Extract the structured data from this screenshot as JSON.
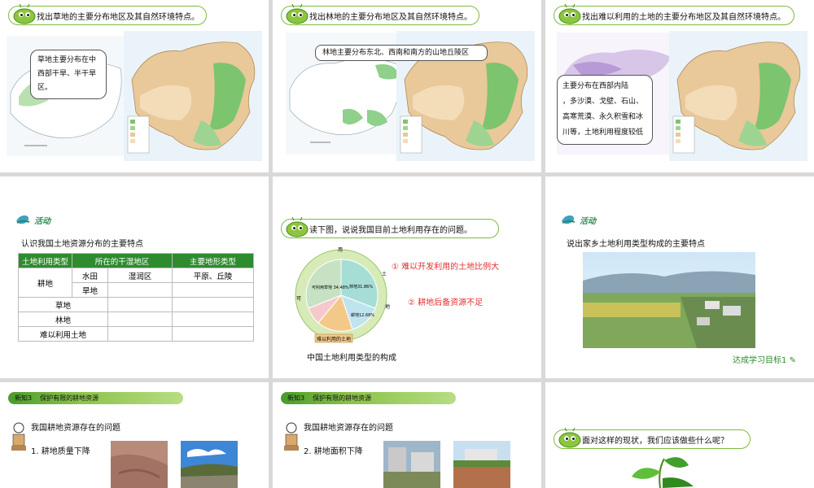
{
  "slide1": {
    "title": "找出草地的主要分布地区及其自然环境特点。",
    "bubble": [
      "草地主要分布在中",
      "西部干旱、半干旱",
      "区。"
    ]
  },
  "slide2": {
    "title": "找出林地的主要分布地区及其自然环境特点。",
    "bubble": "林地主要分布东北、西南和南方的山地丘陵区"
  },
  "slide3": {
    "title": "找出难以利用的土地的主要分布地区及其自然环境特点。",
    "bubble": [
      "主要分布在西部内陆",
      "，多沙漠、戈壁、石山、",
      "高寒荒漠、永久积雪和冰",
      "川等，土地利用程度较低"
    ]
  },
  "slide4": {
    "activity": "活动",
    "text": "认识我国土地资源分布的主要特点",
    "table": {
      "headers": [
        "土地利用类型",
        "所在的干湿地区",
        "主要地形类型"
      ],
      "farmland": "耕地",
      "paddy": "水田",
      "paddy_zone": "湿润区",
      "paddy_terrain": "平原、丘陵",
      "dryland": "旱地",
      "grass": "草地",
      "forest": "林地",
      "hard": "难以利用土地"
    }
  },
  "slide5": {
    "title": "读下图，说说我国目前土地利用存在的问题。",
    "point1": "① 难以开发利用的土地比例大",
    "point2": "② 耕地后备资源不足",
    "caption": "中国土地利用类型的构成",
    "pie": {
      "grass": "可利用草地 34.48%",
      "forest": "林地31.86%",
      "farmland": "耕地12.68%",
      "hard": "难以利用的土地",
      "ring_top": "用",
      "ring_left": "可",
      "ring_right": "土",
      "ring_right2": "地"
    }
  },
  "slide6": {
    "activity": "活动",
    "text": "说出家乡土地利用类型构成的主要特点",
    "target": "达成学习目标1"
  },
  "slide7": {
    "tag": "新知3",
    "band": "保护有限的耕地资源",
    "heading": "我国耕地资源存在的问题",
    "item": "1. 耕地质量下降"
  },
  "slide8": {
    "tag": "新知3",
    "band": "保护有限的耕地资源",
    "heading": "我国耕地资源存在的问题",
    "item": "2. 耕地面积下降"
  },
  "slide9": {
    "title": "面对这样的现状，我们应该做些什么呢？"
  },
  "colors": {
    "accent_green": "#7dbb3c",
    "table_header": "#2e8b2e",
    "problem_red": "#e03030"
  }
}
